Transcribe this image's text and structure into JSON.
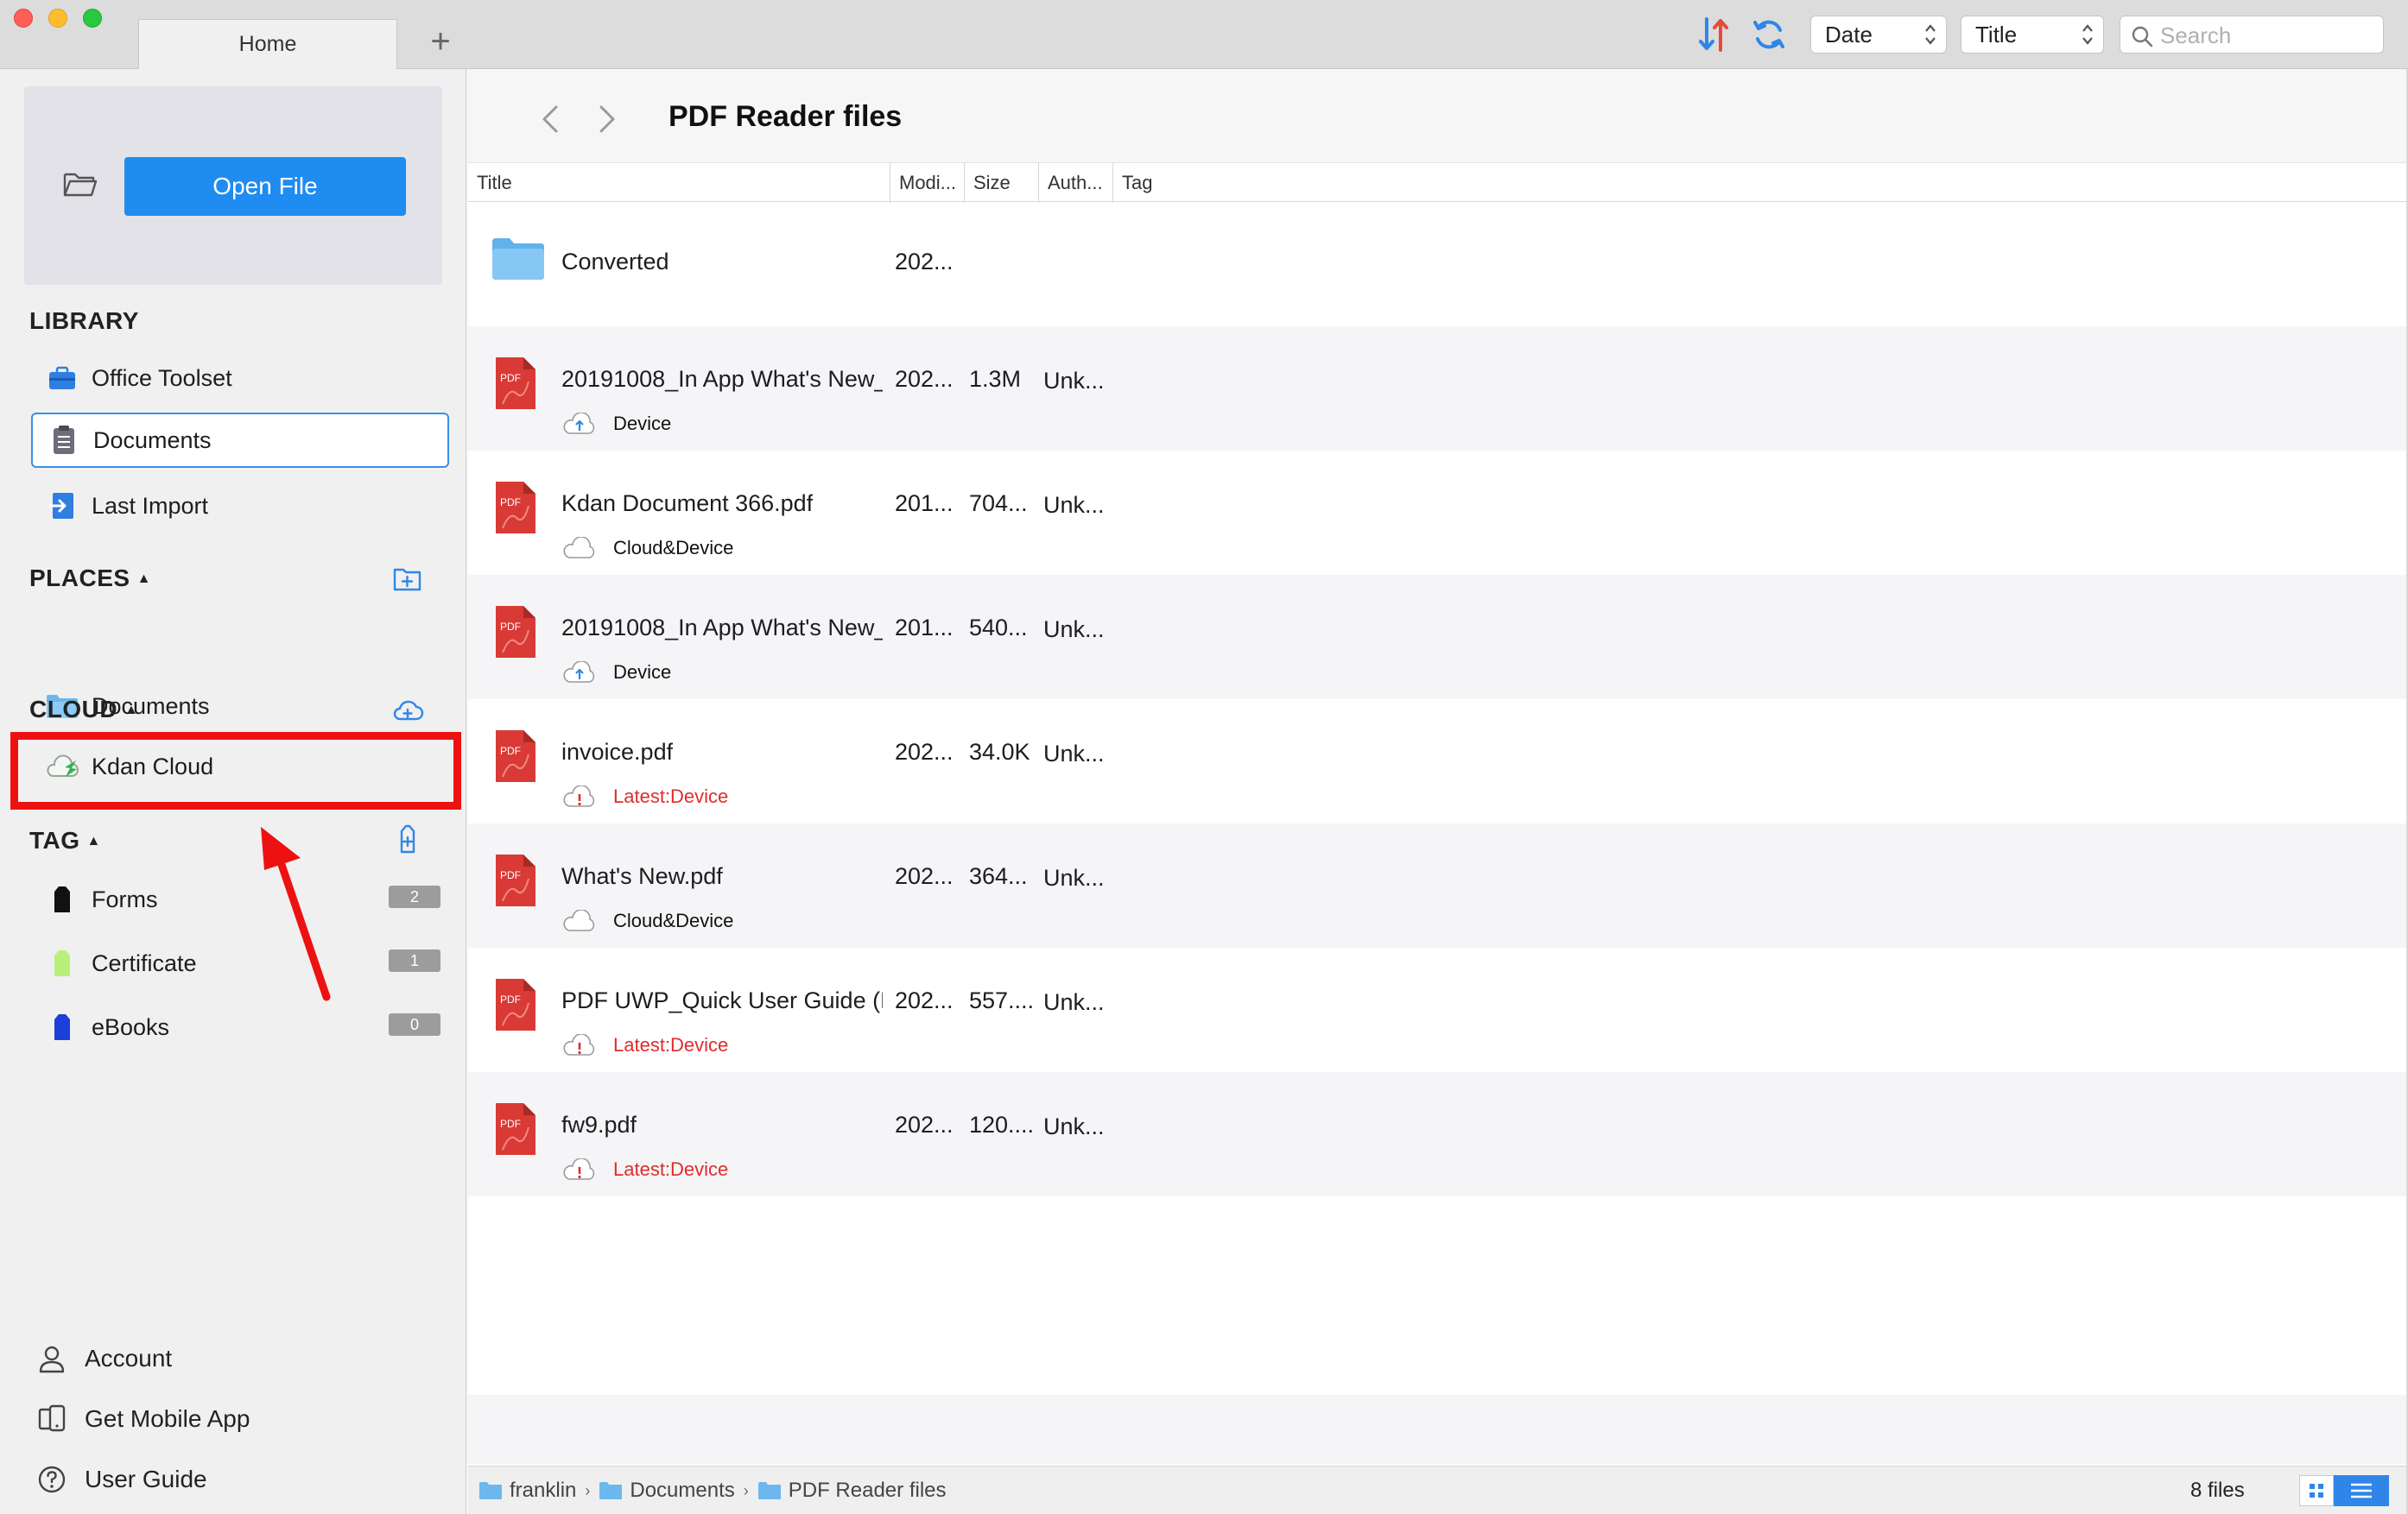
{
  "window": {
    "tab_home": "Home",
    "tab_add_symbol": "+",
    "sort_select": "Date",
    "field_select": "Title",
    "search_placeholder": "Search"
  },
  "sidebar": {
    "open_file": "Open File",
    "library_title": "LIBRARY",
    "library": [
      {
        "label": "Office Toolset",
        "icon": "toolbox-icon"
      },
      {
        "label": "Documents",
        "icon": "document-icon",
        "selected": true
      },
      {
        "label": "Last Import",
        "icon": "import-icon"
      }
    ],
    "places_title": "PLACES",
    "places": [
      {
        "label": "Documents",
        "icon": "folder-icon"
      }
    ],
    "cloud_title": "CLOUD",
    "cloud": [
      {
        "label": "Kdan Cloud",
        "icon": "kdan-cloud-icon",
        "highlighted": true
      }
    ],
    "tag_title": "TAG",
    "tags": [
      {
        "label": "Forms",
        "count": "2",
        "color": "#111111"
      },
      {
        "label": "Certificate",
        "count": "1",
        "color": "#b9f07a"
      },
      {
        "label": "eBooks",
        "count": "0",
        "color": "#1b3fd8"
      }
    ],
    "footer": [
      {
        "label": "Account",
        "icon": "account-icon"
      },
      {
        "label": "Get Mobile App",
        "icon": "mobile-app-icon"
      },
      {
        "label": "User Guide",
        "icon": "help-icon"
      }
    ]
  },
  "main": {
    "title": "PDF Reader files",
    "columns": {
      "title": "Title",
      "modified": "Modi...",
      "size": "Size",
      "author": "Auth...",
      "tag": "Tag"
    },
    "files": [
      {
        "type": "folder",
        "name": "Converted",
        "modified": "202...",
        "size": "",
        "author": "",
        "sync": "",
        "sync_state": ""
      },
      {
        "type": "pdf",
        "name": "20191008_In App What's New_",
        "modified": "202...",
        "size": "1.3M",
        "author": "Unk...",
        "sync": "Device",
        "sync_state": "upload"
      },
      {
        "type": "pdf",
        "name": "Kdan Document 366.pdf",
        "modified": "201...",
        "size": "704...",
        "author": "Unk...",
        "sync": "Cloud&Device",
        "sync_state": "synced"
      },
      {
        "type": "pdf",
        "name": "20191008_In App What's New_",
        "modified": "201...",
        "size": "540...",
        "author": "Unk...",
        "sync": "Device",
        "sync_state": "upload"
      },
      {
        "type": "pdf",
        "name": "invoice.pdf",
        "modified": "202...",
        "size": "34.0K",
        "author": "Unk...",
        "sync": "Latest:Device",
        "sync_state": "warning"
      },
      {
        "type": "pdf",
        "name": "What's New.pdf",
        "modified": "202...",
        "size": "364...",
        "author": "Unk...",
        "sync": "Cloud&Device",
        "sync_state": "synced"
      },
      {
        "type": "pdf",
        "name": "PDF UWP_Quick User Guide (E.",
        "modified": "202...",
        "size": "557....",
        "author": "Unk...",
        "sync": "Latest:Device",
        "sync_state": "warning"
      },
      {
        "type": "pdf",
        "name": "fw9.pdf",
        "modified": "202...",
        "size": "120....",
        "author": "Unk...",
        "sync": "Latest:Device",
        "sync_state": "warning"
      }
    ],
    "pdf_icon_label": "PDF"
  },
  "status": {
    "breadcrumb": [
      "franklin",
      "Documents",
      "PDF Reader files"
    ],
    "count": "8 files"
  },
  "colors": {
    "accent": "#1e8cf0",
    "highlight": "#ee1111",
    "pdf_red": "#d93a35",
    "warning": "#e12b2b"
  }
}
